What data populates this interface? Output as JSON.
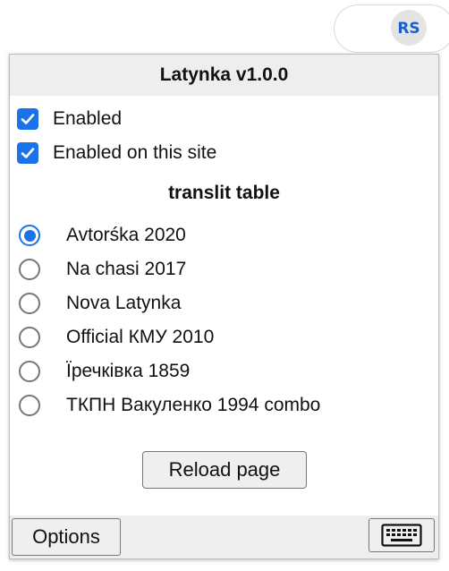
{
  "extension_icon": "rs-logo-icon",
  "popup": {
    "title": "Latynka v1.0.0",
    "checkboxes": [
      {
        "label": "Enabled",
        "checked": true
      },
      {
        "label": "Enabled on this site",
        "checked": true
      }
    ],
    "section_title": "translit table",
    "tables": [
      {
        "label": "Avtorśka 2020",
        "selected": true
      },
      {
        "label": "Na chasi 2017",
        "selected": false
      },
      {
        "label": "Nova Latynka",
        "selected": false
      },
      {
        "label": "Official КМУ 2010",
        "selected": false
      },
      {
        "label": "Їречківка 1859",
        "selected": false
      },
      {
        "label": "ТКПН Вакуленко 1994 combo",
        "selected": false
      }
    ],
    "reload_label": "Reload page",
    "options_label": "Options",
    "keyboard_icon": "keyboard-icon"
  },
  "colors": {
    "accent": "#1a73e8",
    "header_bg": "#eeeeee"
  }
}
